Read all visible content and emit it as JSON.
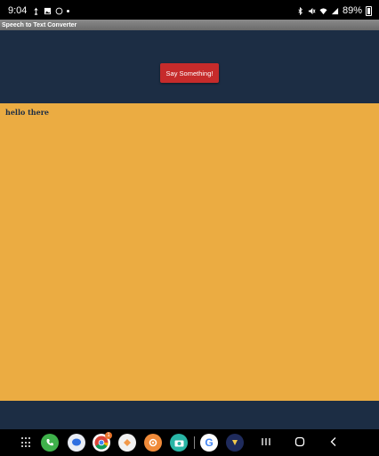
{
  "status": {
    "time": "9:04",
    "battery": "89%"
  },
  "window": {
    "title": "Speech to Text Converter"
  },
  "header": {
    "button_label": "Say Something!"
  },
  "transcript": {
    "text": "hello there"
  },
  "dock": {
    "apps": [
      "phone-icon",
      "messages-icon",
      "chrome-icon",
      "gallery-icon",
      "settings-icon",
      "camera-icon",
      "google-icon",
      "app-icon"
    ],
    "chrome_badge": "1"
  },
  "colors": {
    "header_bg": "#1c2d44",
    "transcript_bg": "#ebac42",
    "button_bg": "#c62b2b"
  }
}
